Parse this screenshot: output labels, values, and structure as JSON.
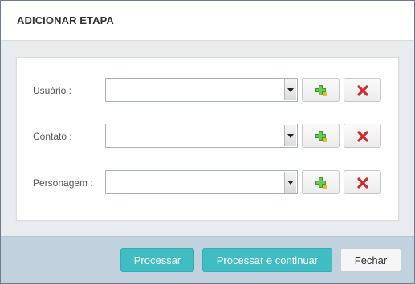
{
  "dialog": {
    "title": "ADICIONAR ETAPA"
  },
  "form": {
    "rows": [
      {
        "label": "Usuário :",
        "value": "",
        "add_icon": "add-green-plus-icon",
        "remove_icon": "remove-red-x-icon"
      },
      {
        "label": "Contato :",
        "value": "",
        "add_icon": "add-green-plus-icon",
        "remove_icon": "remove-red-x-icon"
      },
      {
        "label": "Personagem :",
        "value": "",
        "add_icon": "add-green-plus-icon",
        "remove_icon": "remove-red-x-icon"
      }
    ]
  },
  "footer": {
    "processar_label": "Processar",
    "processar_continuar_label": "Processar e continuar",
    "fechar_label": "Fechar"
  },
  "colors": {
    "primary_button": "#3fbdc3",
    "footer_background": "#c1d1de",
    "add_icon_green": "#3a9a2a",
    "remove_icon_red": "#d42a2a"
  }
}
